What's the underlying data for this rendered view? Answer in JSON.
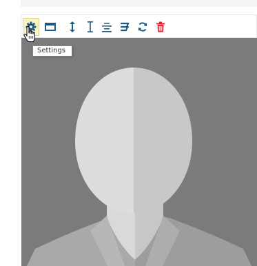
{
  "toolbar": {
    "buttons": [
      {
        "name": "settings",
        "icon": "gear-icon",
        "color": "#1f5a84",
        "active": true
      },
      {
        "name": "frame",
        "icon": "rectangle-icon",
        "color": "#1f5a84"
      },
      {
        "name": "resize-vertical",
        "icon": "double-arrow-vertical-icon",
        "color": "#1f5a84"
      },
      {
        "name": "height",
        "icon": "text-height-icon",
        "color": "#1f5a84"
      },
      {
        "name": "align-center",
        "icon": "align-center-icon",
        "color": "#1f5a84"
      },
      {
        "name": "strikethrough",
        "icon": "strikethrough-icon",
        "color": "#1f5a84"
      },
      {
        "name": "refresh",
        "icon": "refresh-icon",
        "color": "#1f5a84"
      },
      {
        "name": "delete",
        "icon": "trash-icon",
        "color": "#e01f2b"
      }
    ]
  },
  "tooltip": {
    "text": "Settings"
  },
  "photo": {
    "background": "#7b7b7b",
    "placeholder": "avatar-silhouette"
  }
}
